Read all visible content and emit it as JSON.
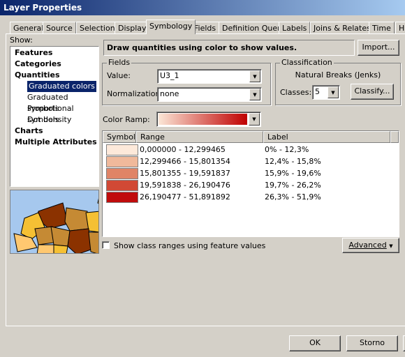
{
  "window": {
    "title": "Layer Properties"
  },
  "tabs": [
    "General",
    "Source",
    "Selection",
    "Display",
    "Symbology",
    "Fields",
    "Definition Query",
    "Labels",
    "Joins & Relates",
    "Time",
    "H"
  ],
  "active_tab": "Symbology",
  "show": {
    "label": "Show:",
    "items": [
      {
        "label": "Features",
        "level": 0
      },
      {
        "label": "Categories",
        "level": 0
      },
      {
        "label": "Quantities",
        "level": 0
      },
      {
        "label": "Graduated colors",
        "level": 1,
        "selected": true
      },
      {
        "label": "Graduated symbols",
        "level": 1
      },
      {
        "label": "Proportional symbols",
        "level": 1
      },
      {
        "label": "Dot density",
        "level": 1
      },
      {
        "label": "Charts",
        "level": 0
      },
      {
        "label": "Multiple Attributes",
        "level": 0
      }
    ]
  },
  "description": "Draw quantities using color to show values.",
  "import_label": "Import...",
  "fields": {
    "title": "Fields",
    "value_label": "Value:",
    "value": "U3_1",
    "normalization_label": "Normalization:",
    "normalization": "none"
  },
  "classification": {
    "title": "Classification",
    "method": "Natural Breaks (Jenks)",
    "classes_label": "Classes:",
    "classes": "5",
    "classify_label": "Classify..."
  },
  "color_ramp": {
    "label": "Color Ramp:",
    "start": "#fbe6d6",
    "end": "#c00000"
  },
  "table": {
    "headers": [
      "Symbol",
      "Range",
      "Label"
    ],
    "rows": [
      {
        "color": "#fde9da",
        "range": "0,000000 - 12,299465",
        "label": "0% - 12,3%"
      },
      {
        "color": "#f0b99b",
        "range": "12,299466 - 15,801354",
        "label": "12,4% - 15,8%"
      },
      {
        "color": "#e08466",
        "range": "15,801355 - 19,591837",
        "label": "15,9% - 19,6%"
      },
      {
        "color": "#d14935",
        "range": "19,591838 - 26,190476",
        "label": "19,7% - 26,2%"
      },
      {
        "color": "#c00c0c",
        "range": "26,190477 - 51,891892",
        "label": "26,3% - 51,9%"
      }
    ]
  },
  "show_ranges_label": "Show class ranges using feature values",
  "advanced_label": "Advanced",
  "ok_label": "OK",
  "cancel_label": "Storno"
}
